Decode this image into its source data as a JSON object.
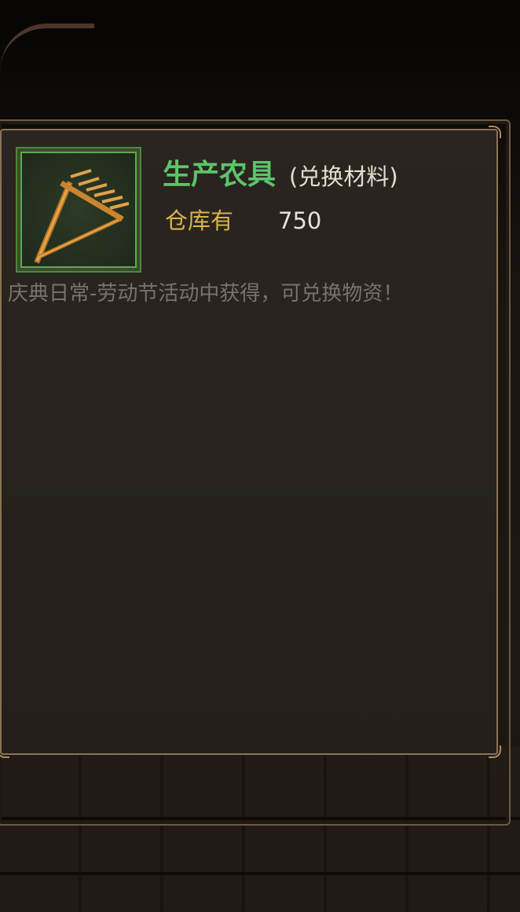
{
  "item": {
    "name": "生产农具",
    "type": "(兑换材料)",
    "stock_label": "仓库有",
    "stock_value": "750",
    "description": "庆典日常-劳动节活动中获得，可兑换物资！",
    "icon": "rake-icon",
    "rarity_color": "#5dc46a"
  },
  "colors": {
    "name": "#5dc46a",
    "stock_label": "#d8b54a",
    "description": "#7a726a",
    "frame": "#8c7356"
  }
}
